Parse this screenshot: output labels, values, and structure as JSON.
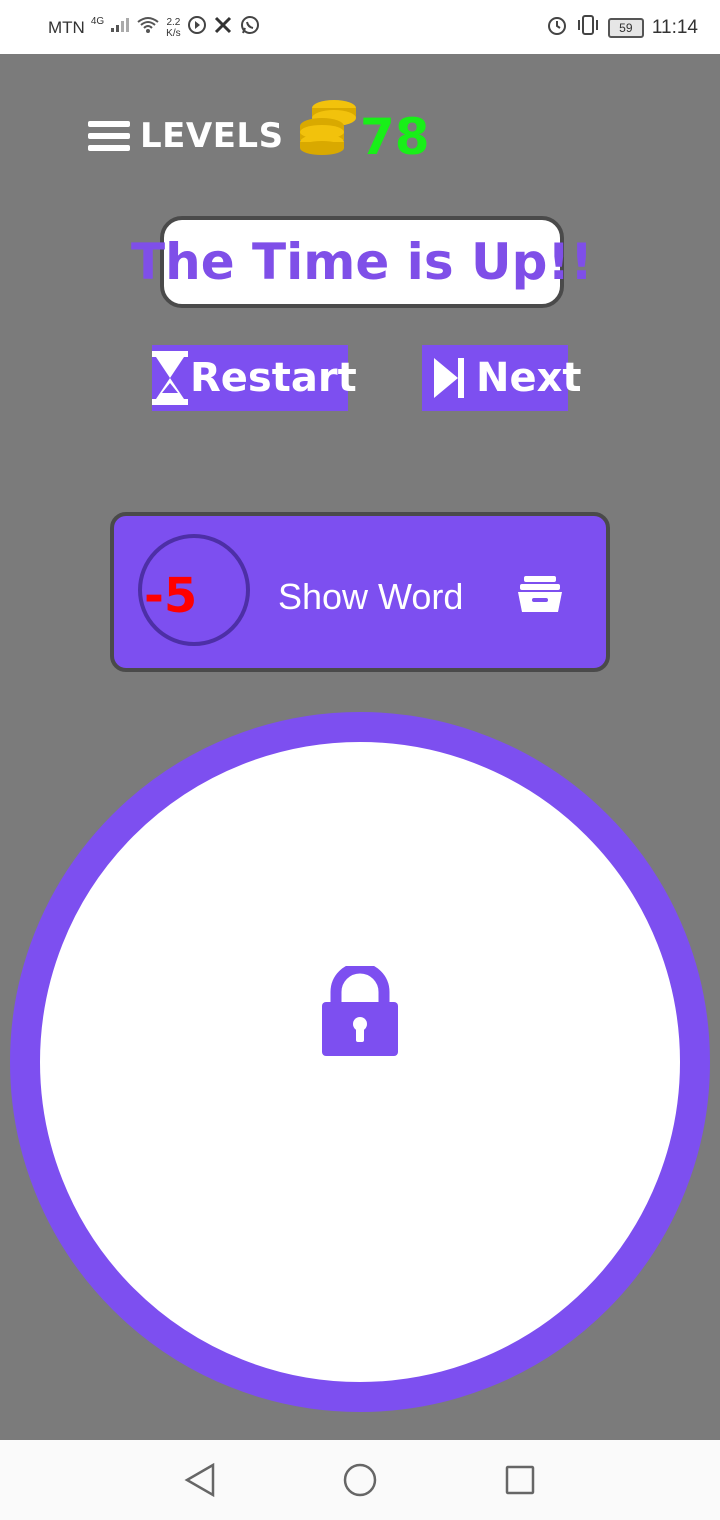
{
  "status_bar": {
    "carrier": "MTN",
    "network": "4G",
    "speed_value": "2.2",
    "speed_unit": "K/s",
    "battery": "59",
    "time": "11:14",
    "icons": [
      "signal-icon",
      "wifi-icon",
      "sync-icon",
      "x-icon",
      "whatsapp-icon",
      "alarm-icon",
      "vibrate-icon",
      "battery-icon"
    ]
  },
  "header": {
    "menu_label": "LEVELS",
    "coin_count": "78",
    "icons": [
      "hamburger-icon",
      "coins-icon"
    ]
  },
  "banner": {
    "text": "The Time is Up!!"
  },
  "actions": {
    "restart_label": "Restart",
    "next_label": "Next",
    "icons": [
      "hourglass-icon",
      "skip-next-icon"
    ]
  },
  "hint": {
    "cost": "-5",
    "label": "Show Word",
    "icon": "archive-icon"
  },
  "lock": {
    "icon": "lock-icon"
  },
  "nav": {
    "icons": [
      "back-icon",
      "home-icon",
      "recent-apps-icon"
    ]
  },
  "colors": {
    "accent": "#7d4ff0",
    "background": "#7b7b7b",
    "coin_text": "#18ef18",
    "cost_text": "#ff0000",
    "coin_gold": "#f2c20c"
  }
}
